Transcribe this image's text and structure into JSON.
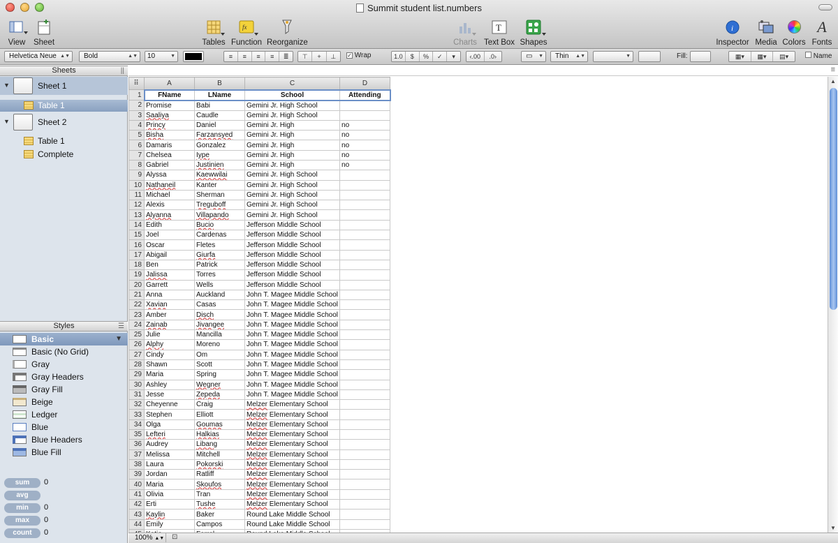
{
  "window": {
    "title": "Summit student list.numbers"
  },
  "toolbar": {
    "view": "View",
    "sheet": "Sheet",
    "tables": "Tables",
    "function": "Function",
    "reorganize": "Reorganize",
    "charts": "Charts",
    "textbox": "Text Box",
    "shapes": "Shapes",
    "inspector": "Inspector",
    "media": "Media",
    "colors": "Colors",
    "fonts": "Fonts"
  },
  "format": {
    "font": "Helvetica Neue",
    "weight": "Bold",
    "size": "10",
    "wrap": "Wrap",
    "border": "Thin",
    "fill": "Fill:",
    "name": "Name",
    "text_color": "#000000"
  },
  "sidebar": {
    "sheets_header": "Sheets",
    "sheet1": "Sheet 1",
    "sheet1_table": "Table 1",
    "sheet2": "Sheet 2",
    "sheet2_table": "Table 1",
    "sheet2_complete": "Complete",
    "styles_header": "Styles",
    "styles": [
      "Basic",
      "Basic (No Grid)",
      "Gray",
      "Gray Headers",
      "Gray Fill",
      "Beige",
      "Ledger",
      "Blue",
      "Blue Headers",
      "Blue Fill"
    ],
    "stats": [
      {
        "label": "sum",
        "value": "0"
      },
      {
        "label": "avg",
        "value": ""
      },
      {
        "label": "min",
        "value": "0"
      },
      {
        "label": "max",
        "value": "0"
      },
      {
        "label": "count",
        "value": "0"
      }
    ]
  },
  "table": {
    "col_letters": [
      "A",
      "B",
      "C",
      "D"
    ],
    "headers": [
      "FName",
      "LName",
      "School",
      "Attending"
    ],
    "rows": [
      [
        "Promise",
        "Babi",
        "Gemini Jr. High School",
        ""
      ],
      [
        "Saaliya",
        "Caudle",
        "Gemini Jr. High School",
        ""
      ],
      [
        "Princy",
        "Daniel",
        "Gemini Jr. High",
        "no"
      ],
      [
        "Bisha",
        "Farzansyed",
        "Gemini Jr. High",
        "no"
      ],
      [
        "Damaris",
        "Gonzalez",
        "Gemini Jr. High",
        "no"
      ],
      [
        "Chelsea",
        "Iype",
        "Gemini Jr. High",
        "no"
      ],
      [
        "Gabriel",
        "Justinien",
        "Gemini Jr. High",
        "no"
      ],
      [
        "Alyssa",
        "Kaewwilai",
        "Gemini Jr. High School",
        ""
      ],
      [
        "Nathaneil",
        "Kanter",
        "Gemini Jr. High School",
        ""
      ],
      [
        "Michael",
        "Sherman",
        "Gemini Jr. High School",
        ""
      ],
      [
        "Alexis",
        "Treguboff",
        "Gemini Jr. High School",
        ""
      ],
      [
        "Alyanna",
        "Villapando",
        "Gemini Jr. High School",
        ""
      ],
      [
        "Edith",
        "Bucio",
        "Jefferson Middle School",
        ""
      ],
      [
        "Joel",
        "Cardenas",
        "Jefferson Middle School",
        ""
      ],
      [
        "Oscar",
        "Fletes",
        "Jefferson Middle School",
        ""
      ],
      [
        "Abigail",
        "Giurfa",
        "Jefferson Middle School",
        ""
      ],
      [
        "Ben",
        "Patrick",
        "Jefferson Middle School",
        ""
      ],
      [
        "Jalissa",
        "Torres",
        "Jefferson Middle School",
        ""
      ],
      [
        "Garrett",
        "Wells",
        "Jefferson Middle School",
        ""
      ],
      [
        "Anna",
        "Auckland",
        "John T. Magee Middle School",
        ""
      ],
      [
        "Xavian",
        "Casas",
        "John T. Magee Middle School",
        ""
      ],
      [
        "Amber",
        "Disch",
        "John T. Magee Middle School",
        ""
      ],
      [
        "Zainab",
        "Jivangee",
        "John T. Magee Middle School",
        ""
      ],
      [
        "Julie",
        "Mancilla",
        "John T. Magee Middle School",
        ""
      ],
      [
        "Alphy",
        "Moreno",
        "John T. Magee Middle School",
        ""
      ],
      [
        "Cindy",
        "Om",
        "John T. Magee Middle School",
        ""
      ],
      [
        "Shawn",
        "Scott",
        "John T. Magee Middle School",
        ""
      ],
      [
        "Maria",
        "Spring",
        "John T. Magee Middle School",
        ""
      ],
      [
        "Ashley",
        "Wegner",
        "John T. Magee Middle School",
        ""
      ],
      [
        "Jesse",
        "Zepeda",
        "John T. Magee Middle School",
        ""
      ],
      [
        "Cheyenne",
        "Craig",
        "Melzer Elementary School",
        ""
      ],
      [
        "Stephen",
        "Elliott",
        "Melzer Elementary School",
        ""
      ],
      [
        "Olga",
        "Goumas",
        "Melzer Elementary School",
        ""
      ],
      [
        "Lefteri",
        "Halkias",
        "Melzer Elementary School",
        ""
      ],
      [
        "Audrey",
        "Libang",
        "Melzer Elementary School",
        ""
      ],
      [
        "Melissa",
        "Mitchell",
        "Melzer Elementary School",
        ""
      ],
      [
        "Laura",
        "Pokorski",
        "Melzer Elementary School",
        ""
      ],
      [
        "Jordan",
        "Ratliff",
        "Melzer Elementary School",
        ""
      ],
      [
        "Maria",
        "Skoufos",
        "Melzer Elementary School",
        ""
      ],
      [
        "Olivia",
        "Tran",
        "Melzer Elementary School",
        ""
      ],
      [
        "Erti",
        "Tushe",
        "Melzer Elementary School",
        ""
      ],
      [
        "Kaylin",
        "Baker",
        "Round Lake Middle School",
        ""
      ],
      [
        "Emily",
        "Campos",
        "Round Lake Middle School",
        ""
      ],
      [
        "Katie",
        "Farrel",
        "Round Lake Middle School",
        ""
      ]
    ]
  },
  "zoom": "100%"
}
